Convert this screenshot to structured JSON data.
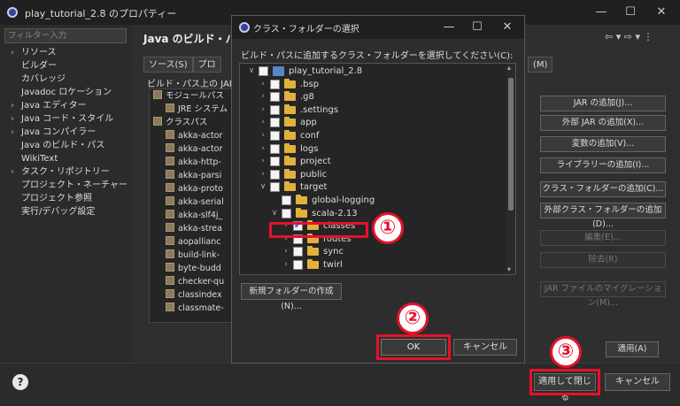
{
  "window": {
    "title": "play_tutorial_2.8 のプロパティー",
    "controls": [
      "—",
      "☐",
      "✕"
    ]
  },
  "left_nav": {
    "filter_placeholder": "フィルター入力",
    "items": [
      {
        "label": "リソース",
        "expandable": true
      },
      {
        "label": "ビルダー",
        "expandable": false
      },
      {
        "label": "カバレッジ",
        "expandable": false
      },
      {
        "label": "Javadoc ロケーション",
        "expandable": false
      },
      {
        "label": "Java エディター",
        "expandable": true
      },
      {
        "label": "Java コード・スタイル",
        "expandable": true
      },
      {
        "label": "Java コンパイラー",
        "expandable": true
      },
      {
        "label": "Java のビルド・パス",
        "expandable": false
      },
      {
        "label": "WikiText",
        "expandable": false
      },
      {
        "label": "タスク・リポジトリー",
        "expandable": true
      },
      {
        "label": "プロジェクト・ネーチャー",
        "expandable": false
      },
      {
        "label": "プロジェクト参照",
        "expandable": false
      },
      {
        "label": "実行/デバッグ設定",
        "expandable": false
      }
    ]
  },
  "build_path": {
    "title": "Java のビルド・パス",
    "nav_arrows": "⇦ ▾ ⇨ ▾ ⋮",
    "tabs": [
      "ソース(S)",
      "プロ"
    ],
    "tab_right": "(M)",
    "list_label": "ビルド・パス上の JAR およ",
    "tree": [
      {
        "label": "モジュールパス",
        "level": 0
      },
      {
        "label": "JRE システム",
        "level": 1
      },
      {
        "label": "クラスパス",
        "level": 0
      },
      {
        "label": "akka-actor",
        "level": 1
      },
      {
        "label": "akka-actor",
        "level": 1
      },
      {
        "label": "akka-http-",
        "level": 1
      },
      {
        "label": "akka-parsi",
        "level": 1
      },
      {
        "label": "akka-proto",
        "level": 1
      },
      {
        "label": "akka-serial",
        "level": 1
      },
      {
        "label": "akka-slf4j_",
        "level": 1
      },
      {
        "label": "akka-strea",
        "level": 1
      },
      {
        "label": "aopallianc",
        "level": 1
      },
      {
        "label": "build-link-",
        "level": 1
      },
      {
        "label": "byte-budd",
        "level": 1
      },
      {
        "label": "checker-qu",
        "level": 1
      },
      {
        "label": "classindex",
        "level": 1
      },
      {
        "label": "classmate-",
        "level": 1
      }
    ],
    "buttons": [
      {
        "label": "JAR の追加(J)...",
        "enabled": true
      },
      {
        "label": "外部 JAR の追加(X)...",
        "enabled": true
      },
      {
        "label": "変数の追加(V)...",
        "enabled": true
      },
      {
        "label": "ライブラリーの追加(I)...",
        "enabled": true
      },
      {
        "label": "クラス・フォルダーの追加(C)...",
        "enabled": true
      },
      {
        "label": "外部クラス・フォルダーの追加(D)...",
        "enabled": true
      },
      {
        "label": "編集(E)...",
        "enabled": false
      },
      {
        "label": "除去(R)",
        "enabled": false
      },
      {
        "label": "JAR ファイルのマイグレーション(M)...",
        "enabled": false
      }
    ],
    "apply_label": "適用(A)"
  },
  "footer": {
    "help": "?",
    "apply_close_label": "適用して閉じる",
    "cancel_label": "キャンセル"
  },
  "dialog": {
    "title": "クラス・フォルダーの選択",
    "controls": [
      "—",
      "☐",
      "✕"
    ],
    "prompt": "ビルド・パスに追加するクラス・フォルダーを選択してください(C):",
    "tree": [
      {
        "label": "play_tutorial_2.8",
        "indent": 0,
        "chevron": "∨",
        "checked": false,
        "icon": "project"
      },
      {
        "label": ".bsp",
        "indent": 1,
        "chevron": "›",
        "checked": false,
        "icon": "folder"
      },
      {
        "label": ".g8",
        "indent": 1,
        "chevron": "›",
        "checked": false,
        "icon": "folder"
      },
      {
        "label": ".settings",
        "indent": 1,
        "chevron": "›",
        "checked": false,
        "icon": "folder"
      },
      {
        "label": "app",
        "indent": 1,
        "chevron": "›",
        "checked": false,
        "icon": "folder"
      },
      {
        "label": "conf",
        "indent": 1,
        "chevron": "›",
        "checked": false,
        "icon": "folder"
      },
      {
        "label": "logs",
        "indent": 1,
        "chevron": "›",
        "checked": false,
        "icon": "folder"
      },
      {
        "label": "project",
        "indent": 1,
        "chevron": "›",
        "checked": false,
        "icon": "folder"
      },
      {
        "label": "public",
        "indent": 1,
        "chevron": "›",
        "checked": false,
        "icon": "folder"
      },
      {
        "label": "target",
        "indent": 1,
        "chevron": "∨",
        "checked": false,
        "icon": "folder"
      },
      {
        "label": "global-logging",
        "indent": 2,
        "chevron": "",
        "checked": false,
        "icon": "folder"
      },
      {
        "label": "scala-2.13",
        "indent": 2,
        "chevron": "∨",
        "checked": false,
        "icon": "folder"
      },
      {
        "label": "classes",
        "indent": 3,
        "chevron": "›",
        "checked": true,
        "icon": "folder"
      },
      {
        "label": "routes",
        "indent": 3,
        "chevron": "›",
        "checked": false,
        "icon": "folder"
      },
      {
        "label": "sync",
        "indent": 3,
        "chevron": "›",
        "checked": false,
        "icon": "folder"
      },
      {
        "label": "twirl",
        "indent": 3,
        "chevron": "›",
        "checked": false,
        "icon": "folder"
      }
    ],
    "new_folder_label": "新規フォルダーの作成(N)...",
    "ok_label": "OK",
    "cancel_label": "キャンセル"
  },
  "annotations": {
    "step1": "①",
    "step2": "②",
    "step3": "③",
    "color": "#e8102a"
  }
}
